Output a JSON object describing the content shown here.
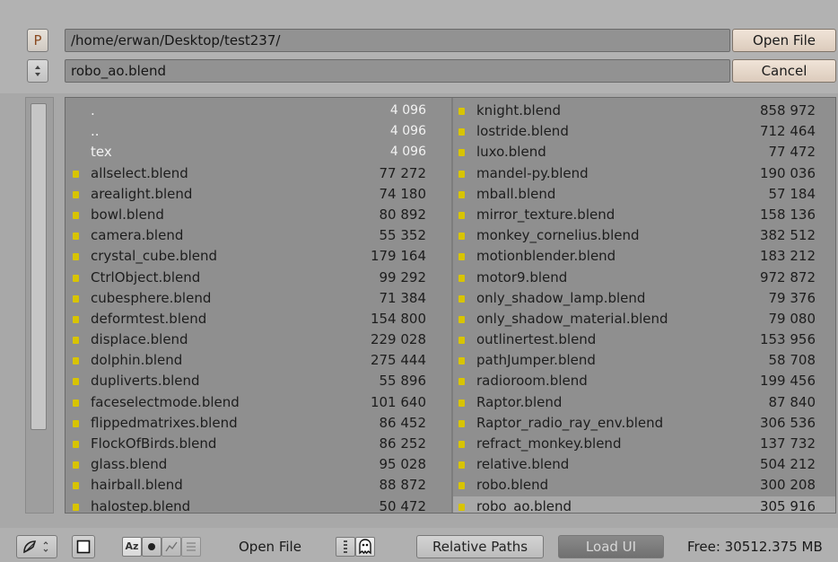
{
  "path": {
    "parent_button_label": "P",
    "directory_value": "/home/erwan/Desktop/test237/",
    "filename_value": "robo_ao.blend",
    "open_label": "Open File",
    "cancel_label": "Cancel"
  },
  "files_left": [
    {
      "name": ".",
      "size": "4 096",
      "type": "dir"
    },
    {
      "name": "..",
      "size": "4 096",
      "type": "dir"
    },
    {
      "name": "tex",
      "size": "4 096",
      "type": "dir"
    },
    {
      "name": "allselect.blend",
      "size": "77 272",
      "type": "file"
    },
    {
      "name": "arealight.blend",
      "size": "74 180",
      "type": "file"
    },
    {
      "name": "bowl.blend",
      "size": "80 892",
      "type": "file"
    },
    {
      "name": "camera.blend",
      "size": "55 352",
      "type": "file"
    },
    {
      "name": "crystal_cube.blend",
      "size": "179 164",
      "type": "file"
    },
    {
      "name": "CtrlObject.blend",
      "size": "99 292",
      "type": "file"
    },
    {
      "name": "cubesphere.blend",
      "size": "71 384",
      "type": "file"
    },
    {
      "name": "deformtest.blend",
      "size": "154 800",
      "type": "file"
    },
    {
      "name": "displace.blend",
      "size": "229 028",
      "type": "file"
    },
    {
      "name": "dolphin.blend",
      "size": "275 444",
      "type": "file"
    },
    {
      "name": "dupliverts.blend",
      "size": "55 896",
      "type": "file"
    },
    {
      "name": "faceselectmode.blend",
      "size": "101 640",
      "type": "file"
    },
    {
      "name": "flippedmatrixes.blend",
      "size": "86 452",
      "type": "file"
    },
    {
      "name": "FlockOfBirds.blend",
      "size": "86 252",
      "type": "file"
    },
    {
      "name": "glass.blend",
      "size": "95 028",
      "type": "file"
    },
    {
      "name": "hairball.blend",
      "size": "88 872",
      "type": "file"
    },
    {
      "name": "halostep.blend",
      "size": "50 472",
      "type": "file"
    }
  ],
  "files_right": [
    {
      "name": "knight.blend",
      "size": "858 972",
      "type": "file"
    },
    {
      "name": "lostride.blend",
      "size": "712 464",
      "type": "file"
    },
    {
      "name": "luxo.blend",
      "size": "77 472",
      "type": "file"
    },
    {
      "name": "mandel-py.blend",
      "size": "190 036",
      "type": "file"
    },
    {
      "name": "mball.blend",
      "size": "57 184",
      "type": "file"
    },
    {
      "name": "mirror_texture.blend",
      "size": "158 136",
      "type": "file"
    },
    {
      "name": "monkey_cornelius.blend",
      "size": "382 512",
      "type": "file"
    },
    {
      "name": "motionblender.blend",
      "size": "183 212",
      "type": "file"
    },
    {
      "name": "motor9.blend",
      "size": "972 872",
      "type": "file"
    },
    {
      "name": "only_shadow_lamp.blend",
      "size": "79 376",
      "type": "file"
    },
    {
      "name": "only_shadow_material.blend",
      "size": "79 080",
      "type": "file"
    },
    {
      "name": "outlinertest.blend",
      "size": "153 956",
      "type": "file"
    },
    {
      "name": "pathJumper.blend",
      "size": "58 708",
      "type": "file"
    },
    {
      "name": "radioroom.blend",
      "size": "199 456",
      "type": "file"
    },
    {
      "name": "Raptor.blend",
      "size": "87 840",
      "type": "file"
    },
    {
      "name": "Raptor_radio_ray_env.blend",
      "size": "306 536",
      "type": "file"
    },
    {
      "name": "refract_monkey.blend",
      "size": "137 732",
      "type": "file"
    },
    {
      "name": "relative.blend",
      "size": "504 212",
      "type": "file"
    },
    {
      "name": "robo.blend",
      "size": "300 208",
      "type": "file"
    },
    {
      "name": "robo_ao.blend",
      "size": "305 916",
      "type": "file",
      "selected": true
    }
  ],
  "bottom": {
    "sort_alpha_label": "Az",
    "open_file_label": "Open File",
    "relative_paths_label": "Relative Paths",
    "load_ui_label": "Load UI",
    "free_space": "Free: 30512.375 MB"
  },
  "colors": {
    "file_marker": "#d8c400",
    "directory_text": "#f2f2f2",
    "selected_row": "#a8a8a8"
  }
}
